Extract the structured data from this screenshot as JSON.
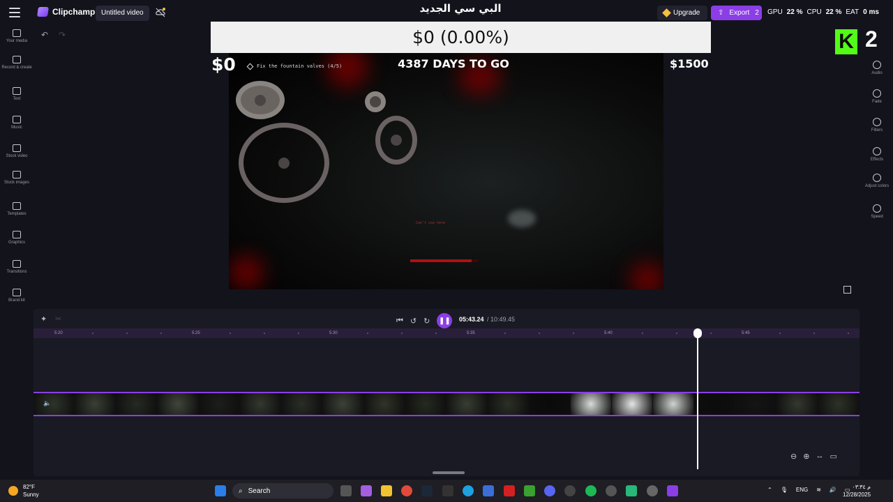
{
  "app": {
    "name": "Clipchamp",
    "project_title": "Untitled video",
    "upgrade_label": "Upgrade",
    "export_label": "Export",
    "export_count": "2"
  },
  "overlay": {
    "arabic_title": "البي سي الجديد",
    "progress_text": "$0 (0.00%)",
    "amount_left": "$0",
    "days_to_go": "4387 DAYS TO GO",
    "amount_right": "$1500",
    "kick_count": "2"
  },
  "stats": {
    "gpu_label": "GPU",
    "gpu_value": "22 %",
    "cpu_label": "CPU",
    "cpu_value": "22 %",
    "eat_label": "EAT",
    "eat_value": "0 ms"
  },
  "game": {
    "objective": "Fix the fountain valves (4/5)",
    "hint": "Can't use here",
    "health_fraction": 0.9
  },
  "left_sidebar": [
    {
      "label": "Your media",
      "icon": "folder-icon"
    },
    {
      "label": "Record & create",
      "icon": "camera-icon"
    },
    {
      "label": "Text",
      "icon": "text-icon"
    },
    {
      "label": "Music",
      "icon": "music-icon"
    },
    {
      "label": "Stock video",
      "icon": "film-icon"
    },
    {
      "label": "Stock images",
      "icon": "image-icon"
    },
    {
      "label": "Templates",
      "icon": "templates-icon"
    },
    {
      "label": "Graphics",
      "icon": "shapes-icon"
    },
    {
      "label": "Transitions",
      "icon": "transition-icon"
    },
    {
      "label": "Brand kit",
      "icon": "brand-icon"
    }
  ],
  "right_sidebar": [
    {
      "label": "Audio",
      "icon": "speaker-icon"
    },
    {
      "label": "Fade",
      "icon": "fade-icon"
    },
    {
      "label": "Filters",
      "icon": "filter-icon"
    },
    {
      "label": "Effects",
      "icon": "wand-icon"
    },
    {
      "label": "Adjust colors",
      "icon": "contrast-icon"
    },
    {
      "label": "Speed",
      "icon": "speedometer-icon"
    }
  ],
  "timeline": {
    "current_time": "05:43.24",
    "total_time": "/ 10:49.45",
    "ruler_labels": [
      "5:20",
      "5:25",
      "5:30",
      "5:35",
      "5:40",
      "5:45"
    ]
  },
  "taskbar": {
    "temperature": "82°F",
    "condition": "Sunny",
    "search_placeholder": "Search",
    "language": "ENG",
    "time": "م ٠٣:٣٤",
    "date": "12/28/2025"
  },
  "colors": {
    "accent": "#8b3ee6",
    "kick_green": "#53fc18",
    "upgrade_gold": "#f6c042"
  }
}
